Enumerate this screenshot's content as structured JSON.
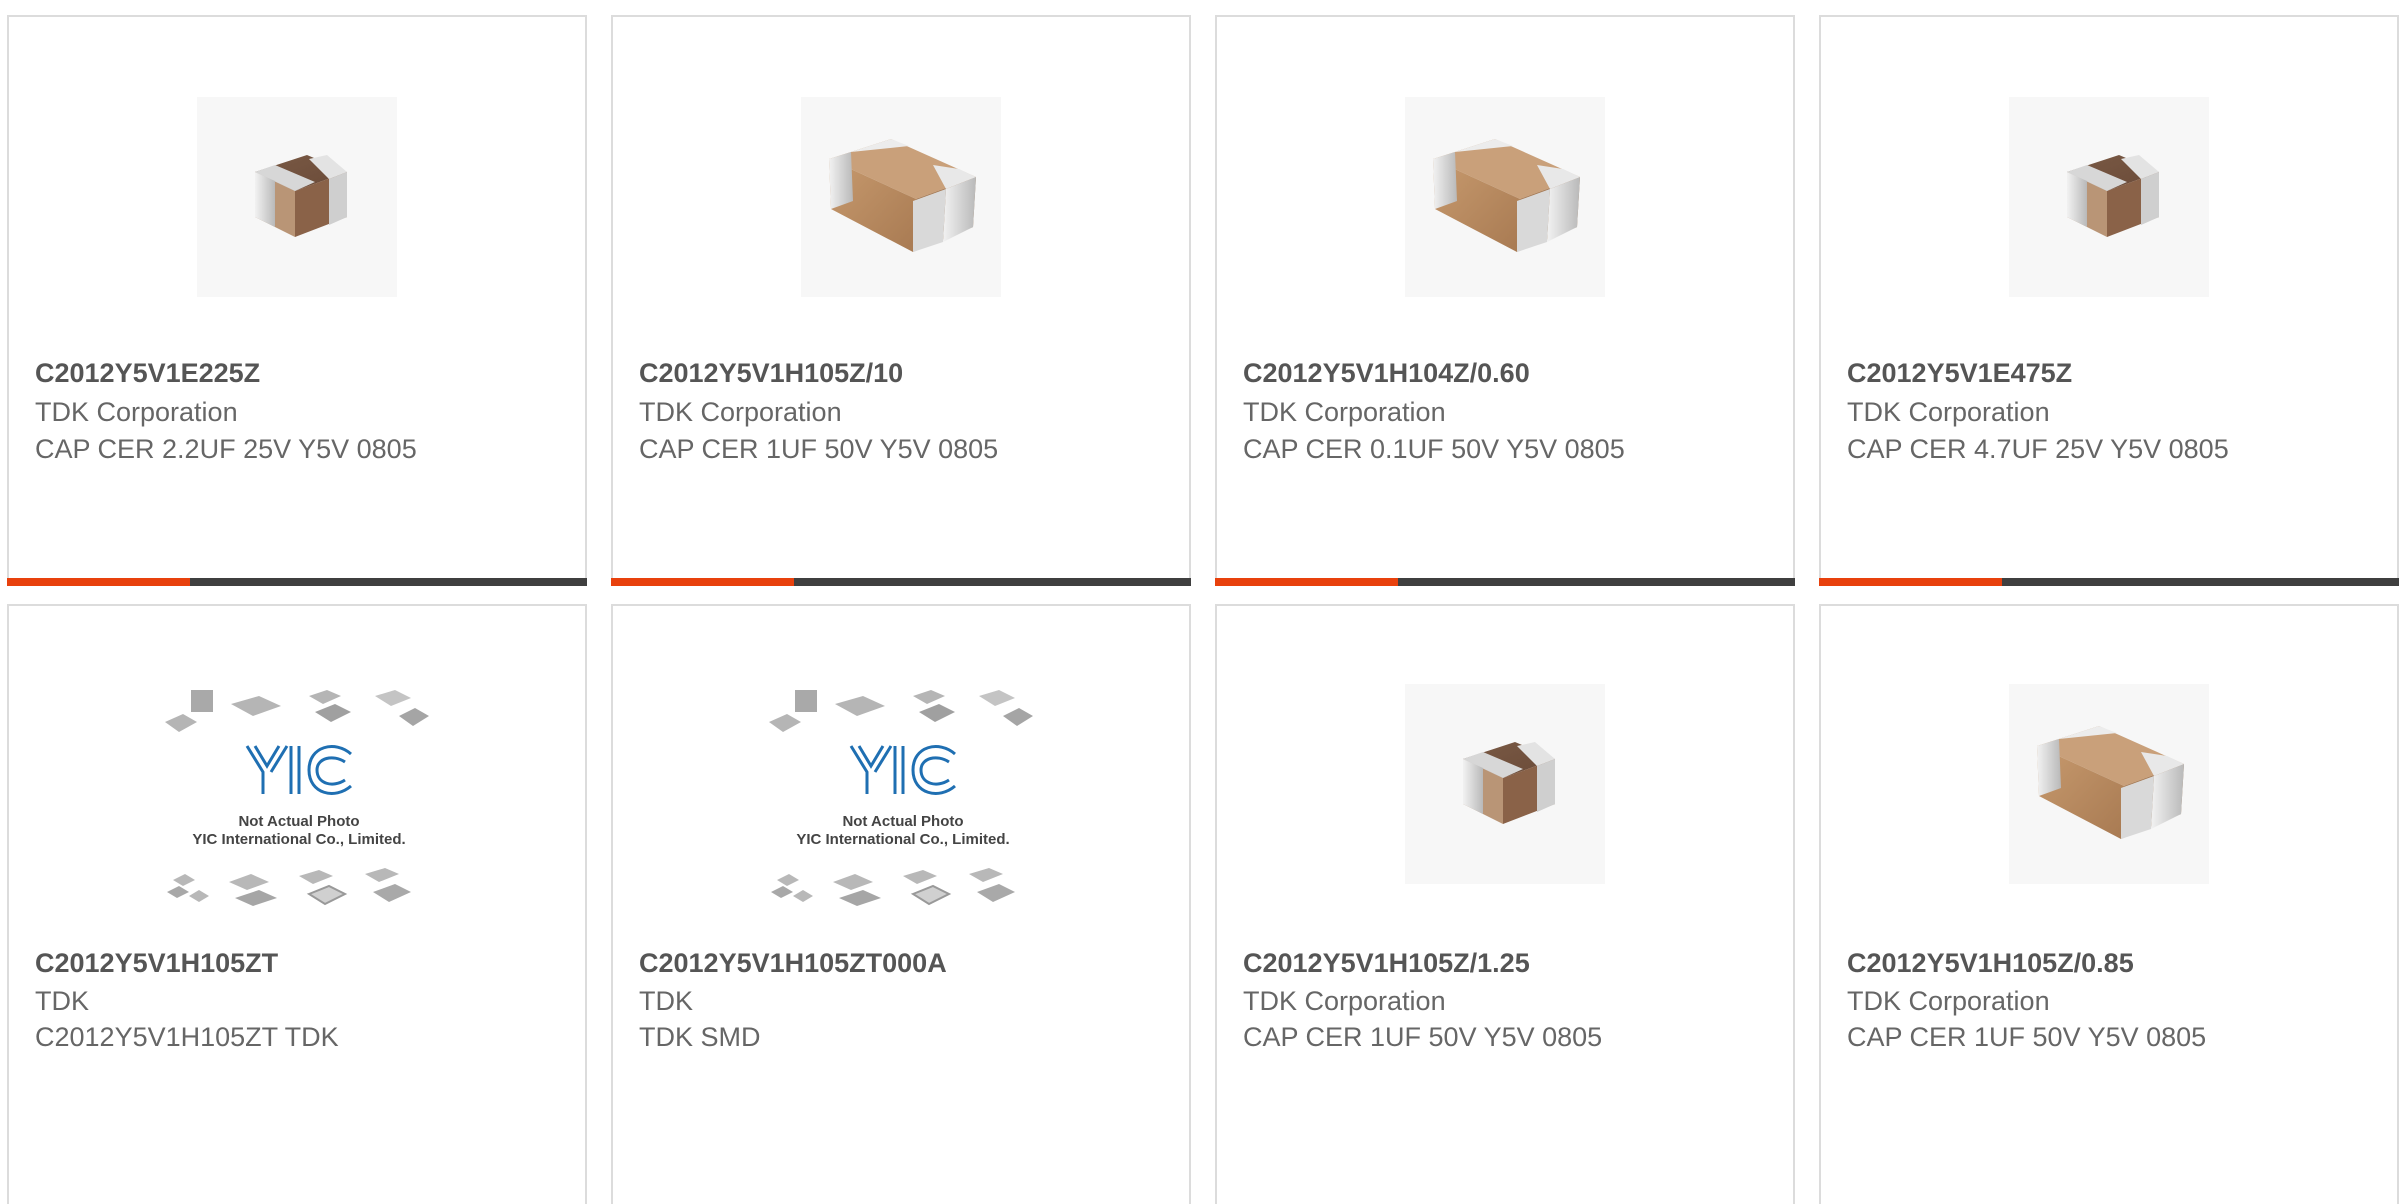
{
  "colors": {
    "accent": "#e8410d",
    "bar_dark": "#3f3f3f",
    "border": "#dcdcdc",
    "text_bold": "#555555",
    "text": "#666666"
  },
  "products": [
    {
      "part_number": "C2012Y5V1E225Z",
      "manufacturer": "TDK Corporation",
      "description": "CAP CER 2.2UF 25V Y5V 0805",
      "image": "mlcc-small-icon"
    },
    {
      "part_number": "C2012Y5V1H105Z/10",
      "manufacturer": "TDK Corporation",
      "description": "CAP CER 1UF 50V Y5V 0805",
      "image": "mlcc-large-icon"
    },
    {
      "part_number": "C2012Y5V1H104Z/0.60",
      "manufacturer": "TDK Corporation",
      "description": "CAP CER 0.1UF 50V Y5V 0805",
      "image": "mlcc-large-icon"
    },
    {
      "part_number": "C2012Y5V1E475Z",
      "manufacturer": "TDK Corporation",
      "description": "CAP CER 4.7UF 25V Y5V 0805",
      "image": "mlcc-small-icon"
    },
    {
      "part_number": "C2012Y5V1H105ZT",
      "manufacturer": "TDK",
      "description": "C2012Y5V1H105ZT TDK",
      "image": "yic-placeholder-image",
      "placeholder_line1": "Not Actual Photo",
      "placeholder_line2": "YIC International Co., Limited."
    },
    {
      "part_number": "C2012Y5V1H105ZT000A",
      "manufacturer": "TDK",
      "description": "TDK SMD",
      "image": "yic-placeholder-image",
      "placeholder_line1": "Not Actual Photo",
      "placeholder_line2": "YIC International Co., Limited."
    },
    {
      "part_number": "C2012Y5V1H105Z/1.25",
      "manufacturer": "TDK Corporation",
      "description": "CAP CER 1UF 50V Y5V 0805",
      "image": "mlcc-small-icon"
    },
    {
      "part_number": "C2012Y5V1H105Z/0.85",
      "manufacturer": "TDK Corporation",
      "description": "CAP CER 1UF 50V Y5V 0805",
      "image": "mlcc-large-icon"
    }
  ]
}
